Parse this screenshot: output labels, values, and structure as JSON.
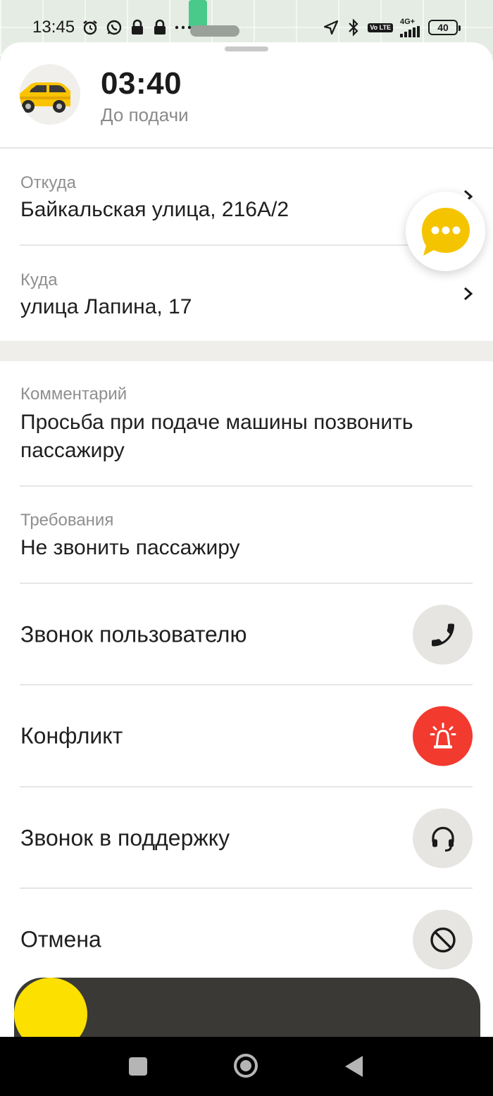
{
  "status_bar": {
    "time": "13:45",
    "net_type": "4G+",
    "lte_label": "Vo LTE",
    "battery": "40"
  },
  "header": {
    "eta": "03:40",
    "eta_caption": "До подачи"
  },
  "route": {
    "from_label": "Откуда",
    "from_value": "Байкальская улица, 216А/2",
    "to_label": "Куда",
    "to_value": "улица Лапина, 17"
  },
  "details": {
    "comment_label": "Комментарий",
    "comment_value": "Просьба при подаче машины позвонить пассажиру",
    "requirements_label": "Требования",
    "requirements_value": "Не звонить пассажиру"
  },
  "actions": [
    {
      "label": "Звонок пользователю",
      "icon": "phone-icon"
    },
    {
      "label": "Конфликт",
      "icon": "siren-icon",
      "color": "#f23a2f"
    },
    {
      "label": "Звонок в поддержку",
      "icon": "headset-icon"
    },
    {
      "label": "Отмена",
      "icon": "cancel-icon"
    }
  ],
  "colors": {
    "accent_yellow": "#fce000",
    "danger_red": "#f23a2f",
    "chat_yellow": "#f5c400"
  }
}
